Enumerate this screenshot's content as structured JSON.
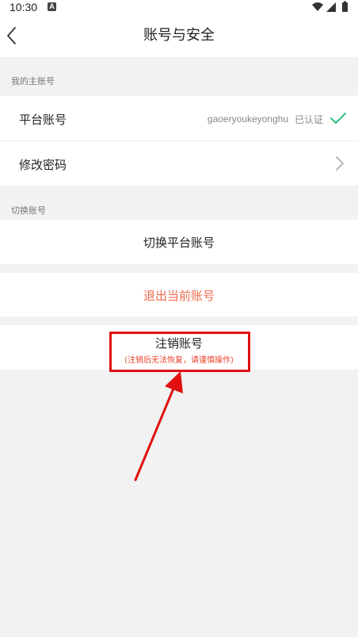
{
  "status_bar": {
    "time": "10:30",
    "notification_icon": "a-icon"
  },
  "nav": {
    "title": "账号与安全",
    "back_icon": "chevron-left-icon"
  },
  "sections": {
    "main_account_header": "我的主账号",
    "switch_account_header": "切换账号"
  },
  "main_account": {
    "platform_label": "平台账号",
    "platform_value": "gaoeryoukeyonghu",
    "verified_text": "已认证",
    "change_password_label": "修改密码"
  },
  "switch_account": {
    "switch_button": "切换平台账号"
  },
  "logout": {
    "label": "退出当前账号"
  },
  "cancel_account": {
    "label": "注销账号",
    "warning": "(注销后无法恢复，请谨慎操作)"
  },
  "colors": {
    "accent_green": "#2fc27a",
    "logout_red": "#f06a4d",
    "warning_red": "#e8442e",
    "annotation_red": "#e01010",
    "background": "#f2f2f2"
  }
}
